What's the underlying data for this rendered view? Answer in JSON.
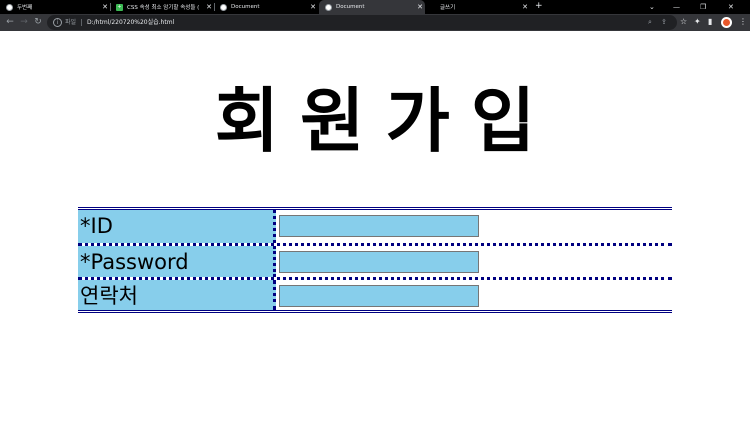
{
  "browser": {
    "tabs": [
      {
        "title": "두번째",
        "favicon": "globe-icon",
        "active": false
      },
      {
        "title": "CSS 속성 최소 암기할 속성들 (",
        "favicon": "green-square-icon",
        "active": false
      },
      {
        "title": "Document",
        "favicon": "globe-icon",
        "active": false
      },
      {
        "title": "Document",
        "favicon": "globe-icon",
        "active": true
      },
      {
        "title": "글쓰기",
        "favicon": "none",
        "active": false
      }
    ],
    "new_tab_label": "+",
    "address_bar": {
      "scheme_label": "파일",
      "url": "D:/html/220720%20실습.html"
    },
    "colors": {
      "tabstrip_bg": "#000000",
      "toolbar_bg": "#35363a",
      "omnibox_bg": "#202124"
    }
  },
  "page": {
    "heading": "회원가입",
    "form": {
      "rows": [
        {
          "label": "*ID",
          "value": "",
          "input_type": "text"
        },
        {
          "label": "*Password",
          "value": "",
          "input_type": "password"
        },
        {
          "label": "연락처",
          "value": "",
          "input_type": "text"
        }
      ]
    },
    "colors": {
      "cell_bg": "#87ceeb",
      "border": "#000080"
    }
  }
}
